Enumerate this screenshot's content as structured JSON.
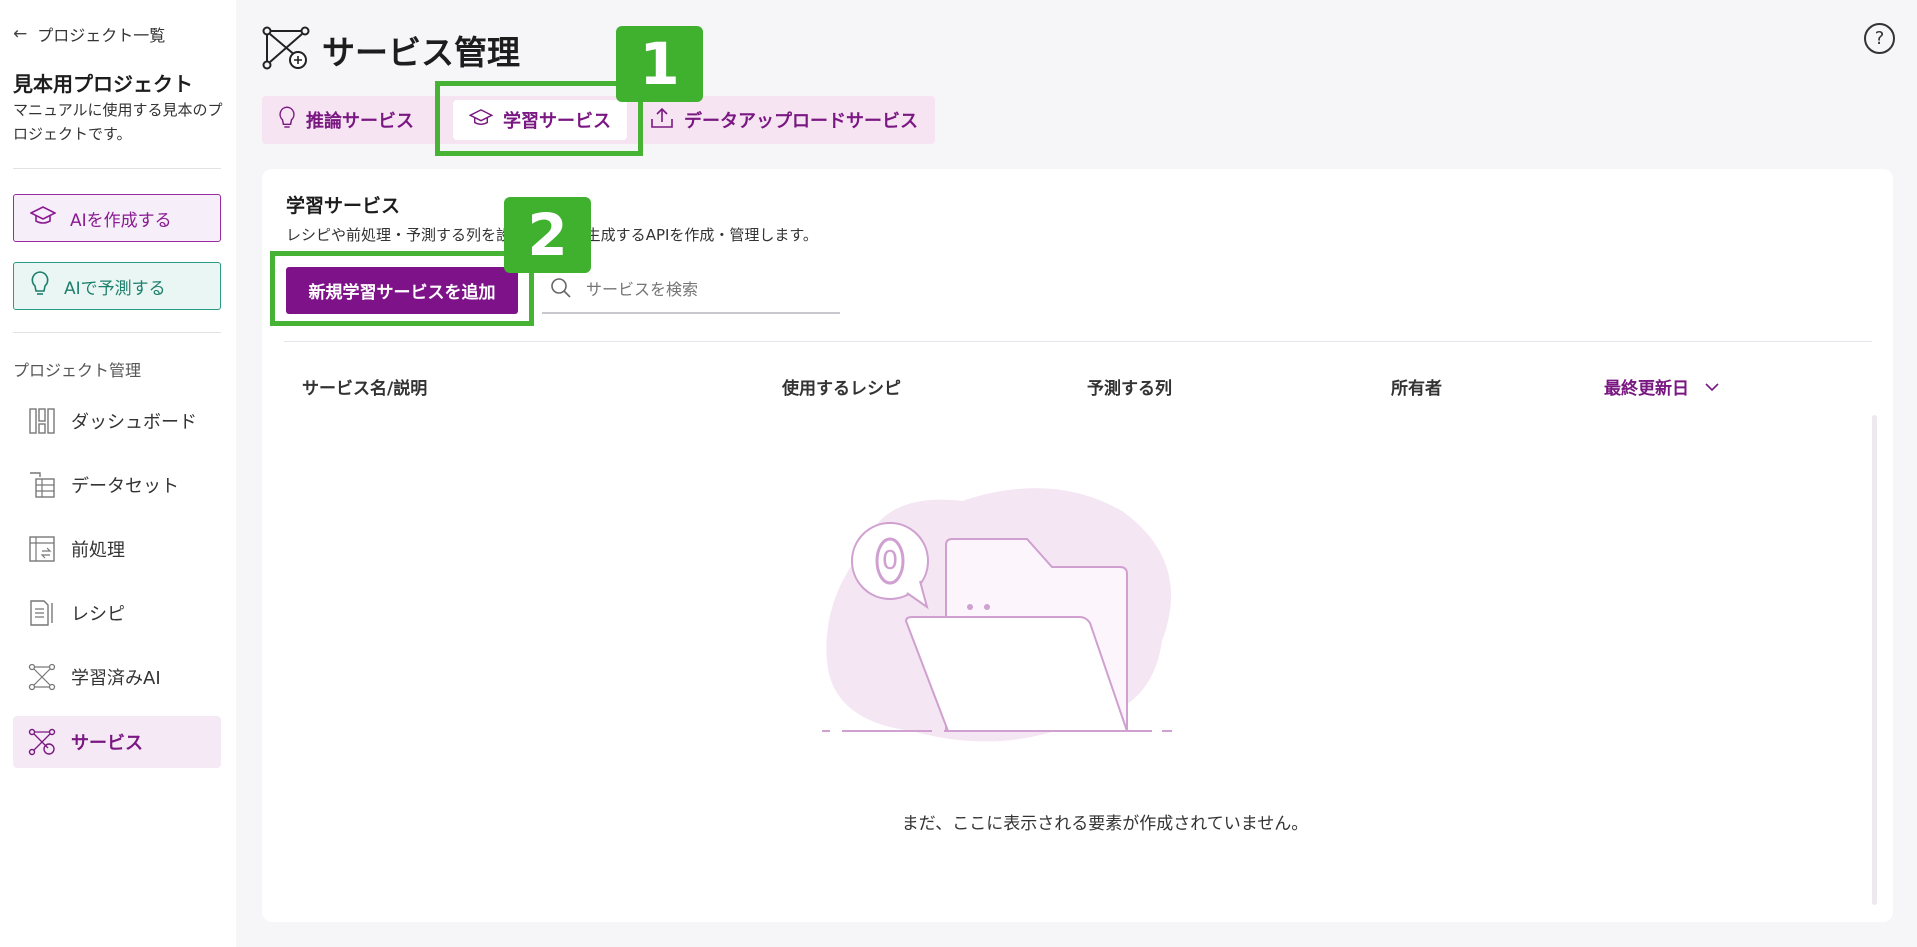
{
  "sidebar": {
    "back_label": "プロジェクト一覧",
    "project_name": "見本用プロジェクト",
    "project_desc": "マニュアルに使用する見本のプロジェクトです。",
    "create_ai_label": "AIを作成する",
    "predict_ai_label": "AIで予測する",
    "section_label": "プロジェクト管理",
    "items": [
      {
        "label": "ダッシュボード",
        "icon": "dashboard-icon"
      },
      {
        "label": "データセット",
        "icon": "dataset-icon"
      },
      {
        "label": "前処理",
        "icon": "preprocess-icon"
      },
      {
        "label": "レシピ",
        "icon": "recipe-icon"
      },
      {
        "label": "学習済みAI",
        "icon": "trained-ai-icon"
      },
      {
        "label": "サービス",
        "icon": "service-icon",
        "active": true
      }
    ]
  },
  "header": {
    "title": "サービス管理",
    "help_label": "?"
  },
  "tabs": [
    {
      "label": "推論サービス",
      "icon": "bulb-icon"
    },
    {
      "label": "学習サービス",
      "icon": "graduation-cap-icon",
      "selected": true
    },
    {
      "label": "データアップロードサービス",
      "icon": "upload-icon"
    }
  ],
  "callouts": [
    "1",
    "2"
  ],
  "main": {
    "title": "学習サービス",
    "description": "レシピや前処理・予測する列を設定し、AIを生成するAPIを作成・管理します。",
    "add_button": "新規学習サービスを追加",
    "search_placeholder": "サービスを検索",
    "columns": [
      "サービス名/説明",
      "使用するレシピ",
      "予測する列",
      "所有者",
      "最終更新日"
    ],
    "empty_message": "まだ、ここに表示される要素が作成されていません。",
    "empty_badge": "0"
  },
  "colors": {
    "accent": "#7e1288",
    "teal": "#2c9b86",
    "callout": "#3fb12f"
  }
}
